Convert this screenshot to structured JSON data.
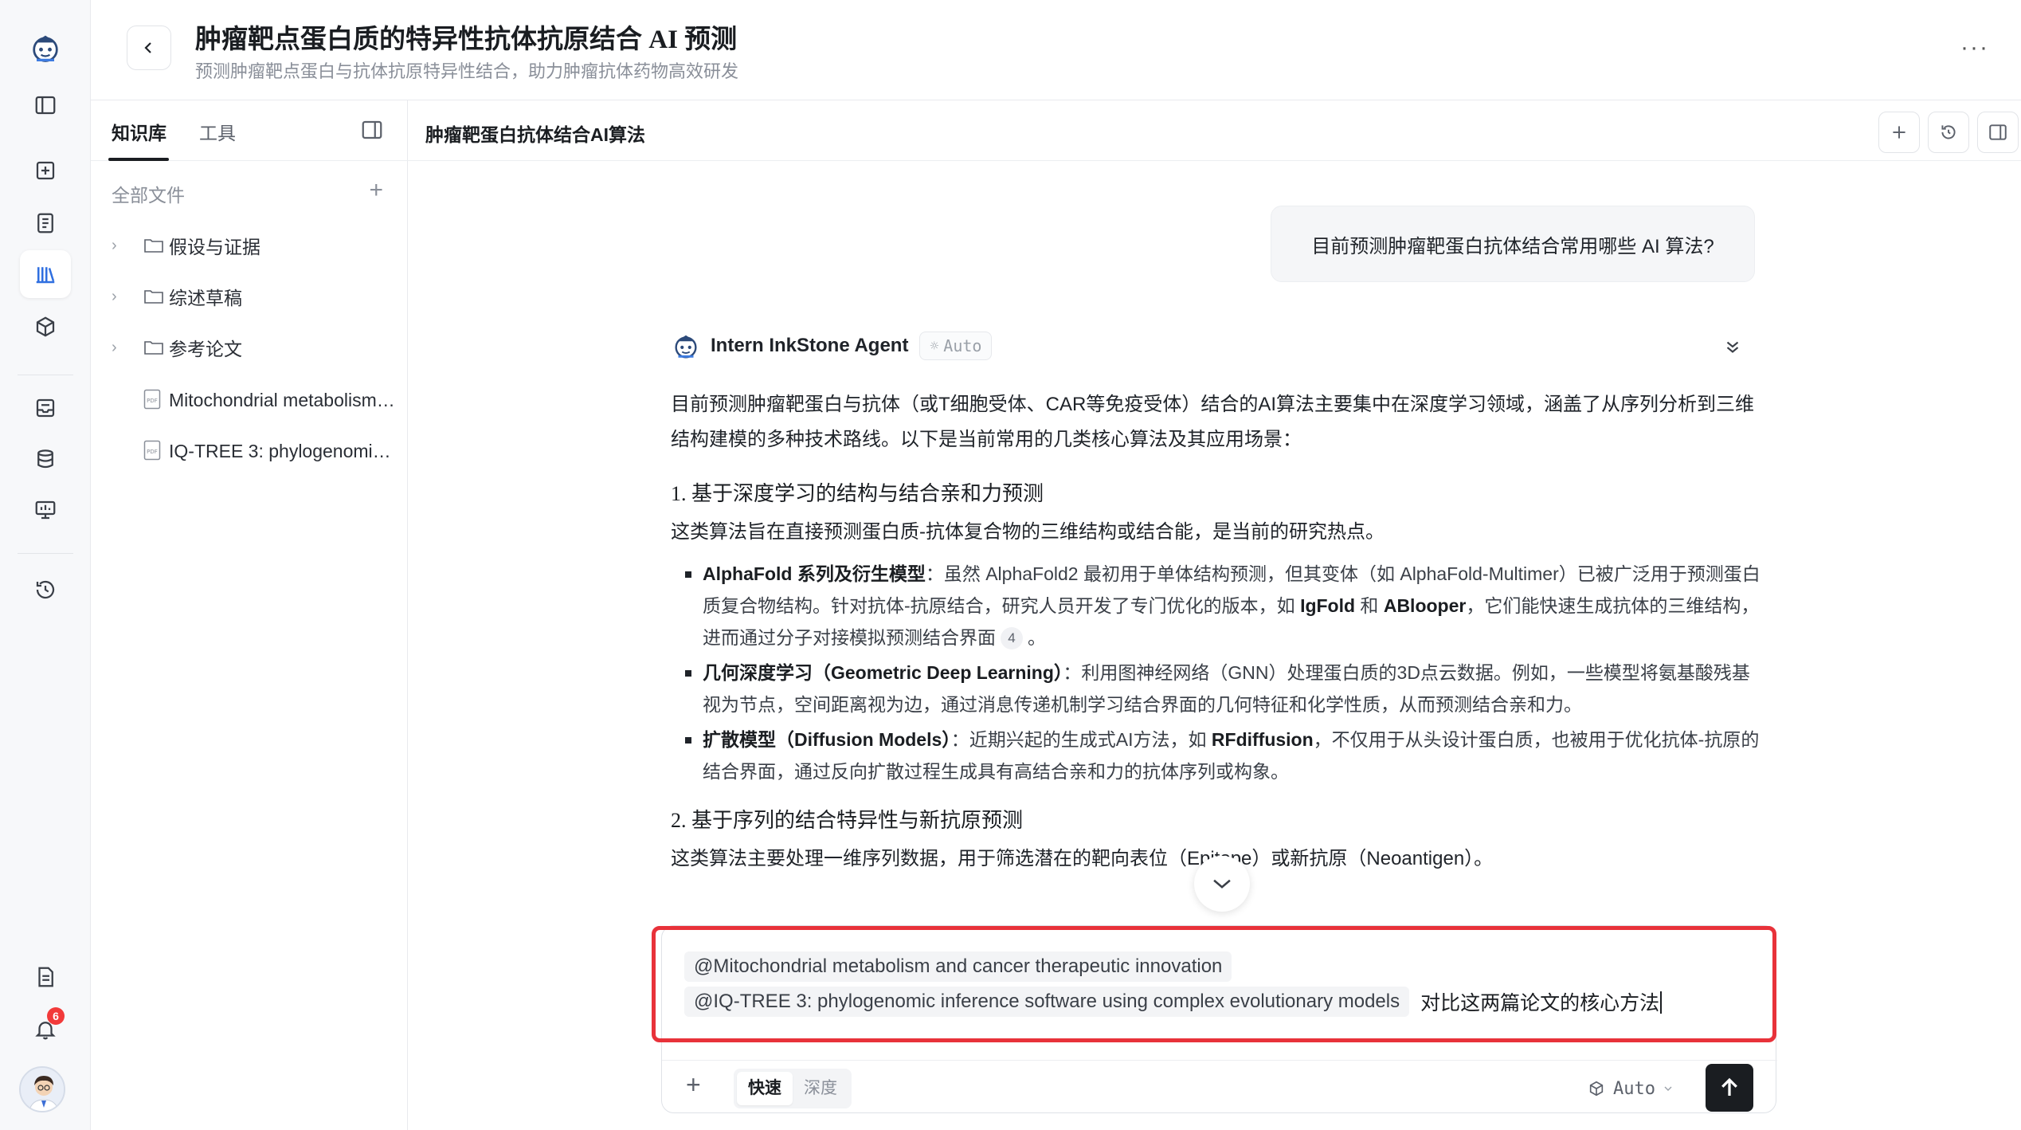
{
  "rail": {
    "notification_count": "6"
  },
  "header": {
    "title": "肿瘤靶点蛋白质的特异性抗体抗原结合 AI 预测",
    "subtitle": "预测肿瘤靶点蛋白与抗体抗原特异性结合，助力肿瘤抗体药物高效研发",
    "more": "···"
  },
  "knowledge": {
    "tabs": [
      {
        "label": "知识库",
        "active": true
      },
      {
        "label": "工具",
        "active": false
      }
    ],
    "all_files": "全部文件",
    "add": "+",
    "folders": [
      {
        "label": "假设与证据"
      },
      {
        "label": "综述草稿"
      },
      {
        "label": "参考论文"
      }
    ],
    "files": [
      {
        "label": "Mitochondrial metabolism and cancer therapeutic innovation"
      },
      {
        "label": "IQ-TREE 3: phylogenomic inference software using complex evolutionary models"
      }
    ]
  },
  "chat": {
    "title": "肿瘤靶蛋白抗体结合AI算法",
    "user_message": "目前预测肿瘤靶蛋白抗体结合常用哪些 AI 算法?",
    "agent": {
      "name": "Intern InkStone Agent",
      "mode": "Auto"
    },
    "answer": {
      "intro": "目前预测肿瘤靶蛋白与抗体（或T细胞受体、CAR等免疫受体）结合的AI算法主要集中在深度学习领域，涵盖了从序列分析到三维结构建模的多种技术路线。以下是当前常用的几类核心算法及其应用场景：",
      "sec1_title": "1. 基于深度学习的结构与结合亲和力预测",
      "sec1_desc": "这类算法旨在直接预测蛋白质-抗体复合物的三维结构或结合能，是当前的研究热点。",
      "b1_title": "AlphaFold 系列及衍生模型",
      "b1_a": "：虽然 AlphaFold2 最初用于单体结构预测，但其变体（如 AlphaFold-Multimer）已被广泛用于预测蛋白质复合物结构。针对抗体-抗原结合，研究人员开发了专门优化的版本，如 ",
      "b1_k1": "IgFold",
      "b1_and": " 和 ",
      "b1_k2": "ABlooper",
      "b1_b": "，它们能快速生成抗体的三维结构，进而通过分子对接模拟预测结合界面",
      "b1_cite": "4",
      "b1_end": "。",
      "b2_title": "几何深度学习（Geometric Deep Learning）",
      "b2_text": "：利用图神经网络（GNN）处理蛋白质的3D点云数据。例如，一些模型将氨基酸残基视为节点，空间距离视为边，通过消息传递机制学习结合界面的几何特征和化学性质，从而预测结合亲和力。",
      "b3_title": "扩散模型（Diffusion Models）",
      "b3_a": "：近期兴起的生成式AI方法，如 ",
      "b3_k": "RFdiffusion",
      "b3_b": "，不仅用于从头设计蛋白质，也被用于优化抗体-抗原的结合界面，通过反向扩散过程生成具有高结合亲和力的抗体序列或构象。",
      "sec2_title": "2. 基于序列的结合特异性与新抗原预测",
      "sec2_desc": "这类算法主要处理一维序列数据，用于筛选潜在的靶向表位（Epitope）或新抗原（Neoantigen）。"
    }
  },
  "composer": {
    "mentions": [
      "@Mitochondrial metabolism and cancer therapeutic innovation",
      "@IQ-TREE 3: phylogenomic inference software using complex evolutionary models"
    ],
    "typed_text": "对比这两篇论文的核心方法",
    "modes": [
      "快速",
      "深度"
    ],
    "model": "Auto"
  }
}
